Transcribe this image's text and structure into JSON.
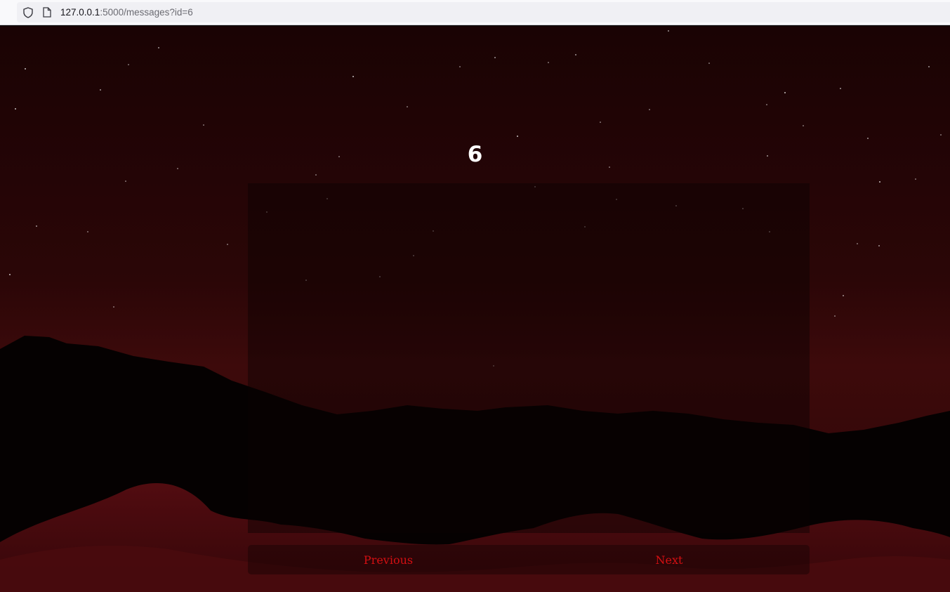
{
  "browser": {
    "url_host": "127.0.0.1",
    "url_rest": ":5000/messages?id=6"
  },
  "message": {
    "title": "6",
    "body": ""
  },
  "navigation": {
    "previous_label": "Previous",
    "next_label": "Next"
  },
  "colors": {
    "link": "#d40f12",
    "title": "#ffffff"
  }
}
